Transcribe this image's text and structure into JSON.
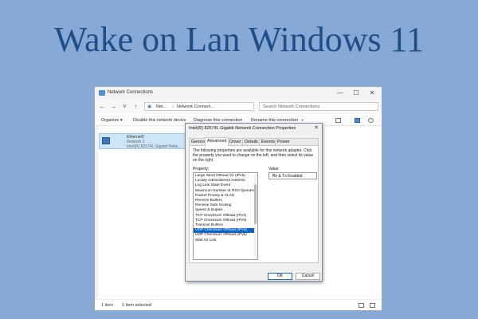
{
  "headline": "Wake on Lan Windows 11",
  "explorer": {
    "title": "Network Connections",
    "window_buttons": [
      "—",
      "☐",
      "✕"
    ],
    "nav_icons": [
      "arrow-left-icon",
      "arrow-right-icon",
      "chevron-down-icon",
      "arrow-up-icon"
    ],
    "address": [
      "Net...",
      "Network Connect..."
    ],
    "search_placeholder": "Search Network Connections",
    "commands": [
      "Organize ▾",
      "Disable this network device",
      "Diagnose this connection",
      "Rename this connection",
      "»"
    ],
    "item": {
      "name": "Ethernet0",
      "network": "Network 2",
      "adapter": "Intel(R) 82574L Gigabit Netw..."
    },
    "status": {
      "count": "1 item",
      "selected": "1 item selected"
    }
  },
  "dialog": {
    "title": "Intel(R) 82574L Gigabit Network Connection Properties",
    "close": "✕",
    "tabs": [
      "General",
      "Advanced",
      "Driver",
      "Details",
      "Events",
      "Power Management"
    ],
    "active_tab": "Advanced",
    "description": "The following properties are available for this network adapter. Click the property you want to change on the left, and then select its value on the right.",
    "property_label": "Property:",
    "value_label": "Value:",
    "properties": [
      "Large Send Offload V2 (IPv6)",
      "Locally Administered Address",
      "Log Link State Event",
      "Maximum Number of RSS Queues",
      "Packet Priority & VLAN",
      "Receive Buffers",
      "Receive Side Scaling",
      "Speed & Duplex",
      "TCP Checksum Offload (IPv4)",
      "TCP Checksum Offload (IPv6)",
      "Transmit Buffers",
      "UDP Checksum Offload (IPv4)",
      "UDP Checksum Offload (IPv6)",
      "Wait for Link"
    ],
    "selected_property": "UDP Checksum Offload (IPv4)",
    "value": "Rx & Tx Enabled",
    "ok": "OK",
    "cancel": "Cancel"
  },
  "colors": {
    "background": "#86a9d6",
    "headline": "#1f4f86",
    "selection": "#0a64c8"
  }
}
